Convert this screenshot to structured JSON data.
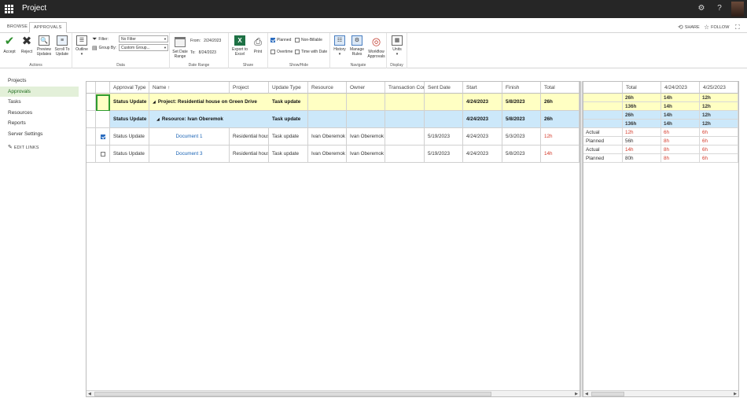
{
  "suite": {
    "title": "Project"
  },
  "tabs": {
    "browse": "BROWSE",
    "approvals": "APPROVALS",
    "share": "SHARE",
    "follow": "FOLLOW"
  },
  "ribbon": {
    "actions": {
      "accept": "Accept",
      "reject": "Reject",
      "preview": "Preview Updates",
      "scroll": "Scroll To Update",
      "label": "Actions"
    },
    "data": {
      "outline": "Outline",
      "filter_label": "Filter:",
      "filter_value": "No Filter",
      "group_label": "Group By:",
      "group_value": "Custom Group...",
      "label": "Data"
    },
    "date_range": {
      "set_date_range": "Set Date Range",
      "from_label": "From:",
      "from_value": "2/24/2023",
      "to_label": "To:",
      "to_value": "8/24/2023",
      "label": "Date Range"
    },
    "share": {
      "export": "Export to Excel",
      "print": "Print",
      "label": "Share"
    },
    "show_hide": {
      "planned": "Planned",
      "non_billable": "Non-Billable",
      "overtime": "Overtime",
      "time_with_date": "Time with Date",
      "label": "Show/Hide"
    },
    "navigate": {
      "history": "History",
      "manage_rules": "Manage Rules",
      "workflow": "Workflow Approvals",
      "label": "Navigate"
    },
    "display": {
      "units": "Units",
      "label": "Display"
    }
  },
  "nav": {
    "items": [
      "Projects",
      "Approvals",
      "Tasks",
      "Resources",
      "Reports",
      "Server Settings"
    ],
    "edit_links": "EDIT LINKS"
  },
  "grid": {
    "headers": [
      "Approval Type",
      "Name",
      "Project",
      "Update Type",
      "Resource",
      "Owner",
      "Transaction Comment",
      "Sent Date",
      "Start",
      "Finish",
      "Total"
    ],
    "group_rows": [
      {
        "approval_type": "Status Update",
        "name": "Project: Residential house on Green Drive",
        "update_type": "Task update",
        "start": "4/24/2023",
        "finish": "5/8/2023",
        "total": "26h"
      },
      {
        "approval_type": "Status Update",
        "name": "Resource: Ivan Oberemok",
        "update_type": "Task update",
        "start": "4/24/2023",
        "finish": "5/8/2023",
        "total": "26h"
      }
    ],
    "rows": [
      {
        "checked": true,
        "approval_type": "Status Update",
        "name": "Document 1",
        "project": "Residential house on Green Drive",
        "update_type": "Task update",
        "resource": "Ivan Oberemok",
        "owner": "Ivan Oberemok",
        "comment": "",
        "sent": "5/19/2023",
        "start": "4/24/2023",
        "finish": "5/3/2023",
        "total": "12h"
      },
      {
        "checked": false,
        "approval_type": "Status Update",
        "name": "Document 3",
        "project": "Residential house on Green Drive",
        "update_type": "Task update",
        "resource": "Ivan Oberemok",
        "owner": "Ivan Oberemok",
        "comment": "",
        "sent": "5/19/2023",
        "start": "4/24/2023",
        "finish": "5/8/2023",
        "total": "14h"
      }
    ]
  },
  "gantt": {
    "headers": [
      "",
      "Total",
      "4/24/2023",
      "4/25/2023"
    ],
    "rows": [
      {
        "kind": "y",
        "label": "",
        "total": "26h",
        "d1": "14h",
        "d2": "12h"
      },
      {
        "kind": "y",
        "label": "",
        "total": "136h",
        "d1": "14h",
        "d2": "12h"
      },
      {
        "kind": "b",
        "label": "",
        "total": "26h",
        "d1": "14h",
        "d2": "12h"
      },
      {
        "kind": "b",
        "label": "",
        "total": "136h",
        "d1": "14h",
        "d2": "12h"
      },
      {
        "kind": "w",
        "label": "Actual",
        "total": "12h",
        "d1": "6h",
        "d2": "6h"
      },
      {
        "kind": "w",
        "label": "Planned",
        "total": "56h",
        "d1": "8h",
        "d2": "6h"
      },
      {
        "kind": "w",
        "label": "Actual",
        "total": "14h",
        "d1": "8h",
        "d2": "6h"
      },
      {
        "kind": "w",
        "label": "Planned",
        "total": "80h",
        "d1": "8h",
        "d2": "6h"
      }
    ]
  }
}
